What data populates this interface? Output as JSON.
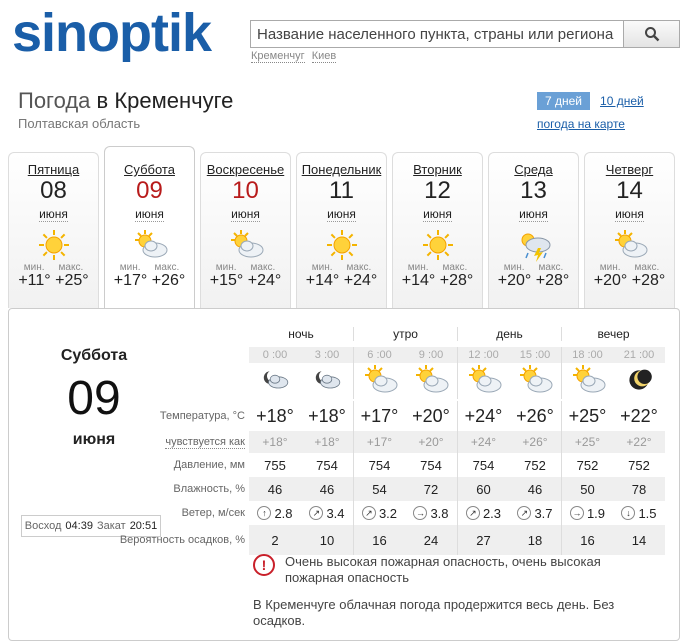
{
  "logo": {
    "text": "sinoptik"
  },
  "search": {
    "placeholder": "Название населенного пункта, страны или региона",
    "button_icon": "search-icon"
  },
  "quick_links": [
    "Кременчуг",
    "Киев"
  ],
  "header": {
    "prefix": "Погода",
    "city": "в Кременчуге",
    "region": "Полтавская область"
  },
  "period": {
    "active": "7 дней",
    "other": "10 дней",
    "map": "погода на карте"
  },
  "days": [
    {
      "name": "Пятница",
      "num": "08",
      "month": "июня",
      "icon": "sun-icon",
      "min_lbl": "мин.",
      "max_lbl": "макс.",
      "min": "+11°",
      "max": "+25°",
      "red": false
    },
    {
      "name": "Суббота",
      "num": "09",
      "month": "июня",
      "icon": "sun-cloud-icon",
      "min_lbl": "мин.",
      "max_lbl": "макс.",
      "min": "+17°",
      "max": "+26°",
      "red": true
    },
    {
      "name": "Воскресенье",
      "num": "10",
      "month": "июня",
      "icon": "sun-cloud-icon",
      "min_lbl": "мин.",
      "max_lbl": "макс.",
      "min": "+15°",
      "max": "+24°",
      "red": true
    },
    {
      "name": "Понедельник",
      "num": "11",
      "month": "июня",
      "icon": "sun-icon",
      "min_lbl": "мин.",
      "max_lbl": "макс.",
      "min": "+14°",
      "max": "+24°",
      "red": false
    },
    {
      "name": "Вторник",
      "num": "12",
      "month": "июня",
      "icon": "sun-icon",
      "min_lbl": "мин.",
      "max_lbl": "макс.",
      "min": "+14°",
      "max": "+28°",
      "red": false
    },
    {
      "name": "Среда",
      "num": "13",
      "month": "июня",
      "icon": "thunderstorm-icon",
      "min_lbl": "мин.",
      "max_lbl": "макс.",
      "min": "+20°",
      "max": "+28°",
      "red": false
    },
    {
      "name": "Четверг",
      "num": "14",
      "month": "июня",
      "icon": "sun-cloud-icon",
      "min_lbl": "мин.",
      "max_lbl": "макс.",
      "min": "+20°",
      "max": "+28°",
      "red": false
    }
  ],
  "selected": {
    "name": "Суббота",
    "num": "09",
    "month": "июня",
    "sunrise_lbl": "Восход",
    "sunrise": "04:39",
    "sunset_lbl": "Закат",
    "sunset": "20:51"
  },
  "table": {
    "periods": [
      "ночь",
      "утро",
      "день",
      "вечер"
    ],
    "times": [
      "0 :00",
      "3 :00",
      "6 :00",
      "9 :00",
      "12 :00",
      "15 :00",
      "18 :00",
      "21 :00"
    ],
    "icons": [
      "moon-cloud-icon",
      "moon-cloud-icon",
      "sun-cloud-icon",
      "sun-cloud-icon",
      "sun-cloud-icon",
      "sun-cloud-icon",
      "sun-cloud-icon",
      "moon-icon"
    ],
    "labels": {
      "temp": "Температура, °C",
      "feels": "чувствуется как",
      "pressure": "Давление, мм",
      "humidity": "Влажность, %",
      "wind": "Ветер, м/сек",
      "precip": "Вероятность осадков, %"
    },
    "temp": [
      "+18°",
      "+18°",
      "+17°",
      "+20°",
      "+24°",
      "+26°",
      "+25°",
      "+22°"
    ],
    "feels": [
      "+18°",
      "+18°",
      "+17°",
      "+20°",
      "+24°",
      "+26°",
      "+25°",
      "+22°"
    ],
    "pressure": [
      "755",
      "754",
      "754",
      "754",
      "754",
      "752",
      "752",
      "752"
    ],
    "humidity": [
      "46",
      "46",
      "54",
      "72",
      "60",
      "46",
      "50",
      "78"
    ],
    "wind": [
      "2.8",
      "3.4",
      "3.2",
      "3.8",
      "2.3",
      "3.7",
      "1.9",
      "1.5"
    ],
    "wind_dir": [
      "↑",
      "↗",
      "↗",
      "→",
      "↗",
      "↗",
      "→",
      "↓"
    ],
    "precip": [
      "2",
      "10",
      "16",
      "24",
      "27",
      "18",
      "16",
      "14"
    ]
  },
  "warning": {
    "icon": "alert-icon",
    "text": "Очень высокая пожарная опасность, очень высокая пожарная опасность"
  },
  "description": "В Кременчуге облачная погода продержится весь день. Без осадков.",
  "colors": {
    "brand": "#1a5ea8",
    "accent_red": "#b81b1b",
    "warning": "#c9202a"
  }
}
